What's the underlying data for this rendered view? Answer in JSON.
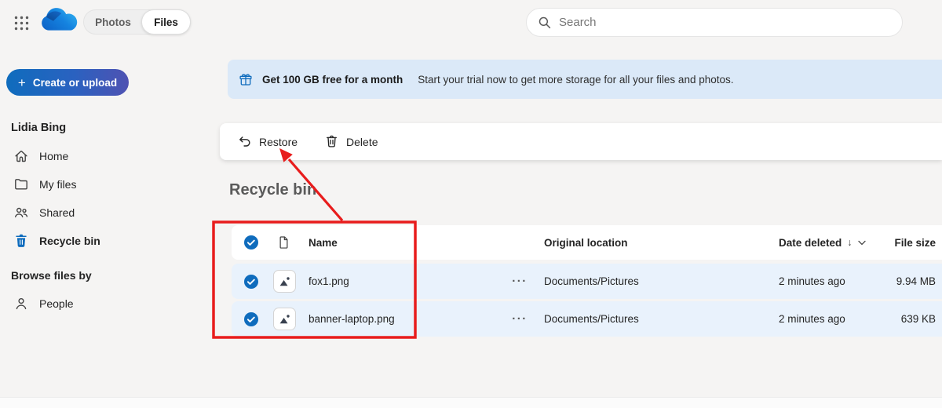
{
  "topbar": {
    "toggle_photos": "Photos",
    "toggle_files": "Files",
    "search_placeholder": "Search"
  },
  "sidebar": {
    "create_plus": "+",
    "create_label": "Create or upload",
    "user_name": "Lidia Bing",
    "nav_home": "Home",
    "nav_my_files": "My files",
    "nav_shared": "Shared",
    "nav_recycle_bin": "Recycle bin",
    "browse_heading": "Browse files by",
    "nav_people": "People"
  },
  "banner": {
    "title": "Get 100 GB free for a month",
    "subtitle": "Start your trial now to get more storage for all your files and photos."
  },
  "toolbar": {
    "restore_label": "Restore",
    "delete_label": "Delete"
  },
  "page": {
    "title": "Recycle bin"
  },
  "table": {
    "header_name": "Name",
    "header_location": "Original location",
    "header_date": "Date deleted",
    "sort_arrow": "↓",
    "header_size": "File size",
    "more_label": "···",
    "rows": [
      {
        "name": "fox1.png",
        "location": "Documents/Pictures",
        "date": "2 minutes ago",
        "size": "9.94 MB"
      },
      {
        "name": "banner-laptop.png",
        "location": "Documents/Pictures",
        "date": "2 minutes ago",
        "size": "639 KB"
      }
    ]
  },
  "colors": {
    "accent": "#0f6cbd",
    "annotation_red": "#e81c1c",
    "selected_row_bg": "#e9f2fc",
    "banner_bg": "#dbe9f8"
  }
}
